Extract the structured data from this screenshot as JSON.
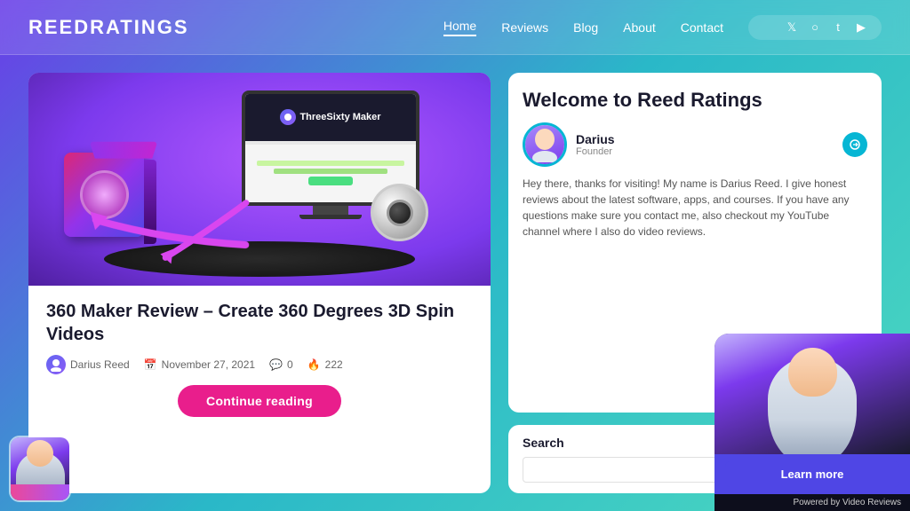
{
  "header": {
    "logo": "ReedRatings",
    "nav": {
      "items": [
        {
          "label": "Home",
          "active": true
        },
        {
          "label": "Reviews",
          "active": false
        },
        {
          "label": "Blog",
          "active": false
        },
        {
          "label": "About",
          "active": false
        },
        {
          "label": "Contact",
          "active": false
        }
      ]
    },
    "social": {
      "icons": [
        "f",
        "t",
        "p",
        "t",
        "yt"
      ]
    }
  },
  "article": {
    "title": "360 Maker Review – Create 360 Degrees 3D Spin Videos",
    "author": "Darius Reed",
    "date": "November 27, 2021",
    "comments": "0",
    "views": "222",
    "continue_label": "Continue reading"
  },
  "sidebar": {
    "welcome": {
      "title": "Welcome to Reed Ratings",
      "author_name": "Darius",
      "author_role": "Founder",
      "body_text": "Hey there, thanks for visiting! My name is Darius Reed. I give honest reviews about the latest software, apps, and courses. If you have any questions make sure you contact me, also checkout my YouTube channel where I also do video reviews."
    },
    "search": {
      "label": "Search",
      "placeholder": ""
    }
  },
  "video_popup": {
    "learn_more_label": "Learn more",
    "powered_by": "Powered by Video Reviews"
  }
}
